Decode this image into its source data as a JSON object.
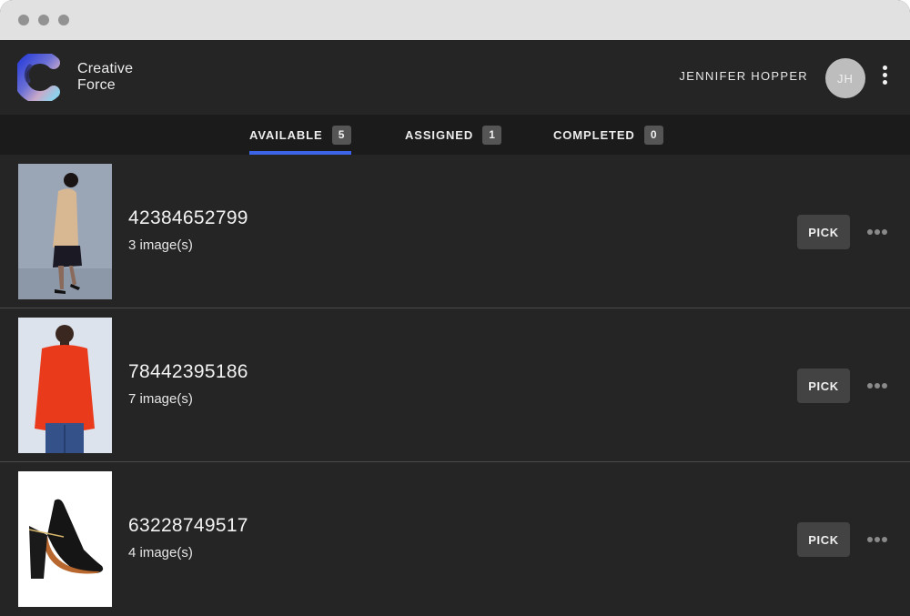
{
  "window": {
    "traffic_lights": [
      "close",
      "minimize",
      "maximize"
    ]
  },
  "header": {
    "brand_line1": "Creative",
    "brand_line2": "Force",
    "user_name": "JENNIFER HOPPER",
    "avatar_initials": "JH",
    "menu_icon": "kebab-vertical-icon"
  },
  "tabs": [
    {
      "label": "AVAILABLE",
      "count": "5",
      "active": true
    },
    {
      "label": "ASSIGNED",
      "count": "1",
      "active": false
    },
    {
      "label": "COMPLETED",
      "count": "0",
      "active": false
    }
  ],
  "items": [
    {
      "code": "42384652799",
      "images": "3 image(s)",
      "thumbnail": "woman-in-beige-coat",
      "action": "PICK",
      "more_icon": "more-horizontal-icon"
    },
    {
      "code": "78442395186",
      "images": "7 image(s)",
      "thumbnail": "man-in-red-sweater",
      "action": "PICK",
      "more_icon": "more-horizontal-icon"
    },
    {
      "code": "63228749517",
      "images": "4 image(s)",
      "thumbnail": "black-high-heel-shoe",
      "action": "PICK",
      "more_icon": "more-horizontal-icon"
    }
  ],
  "colors": {
    "accent": "#3b64e6",
    "background": "#252525",
    "tabbar": "#1b1b1b",
    "titlebar": "#e1e1e1"
  }
}
